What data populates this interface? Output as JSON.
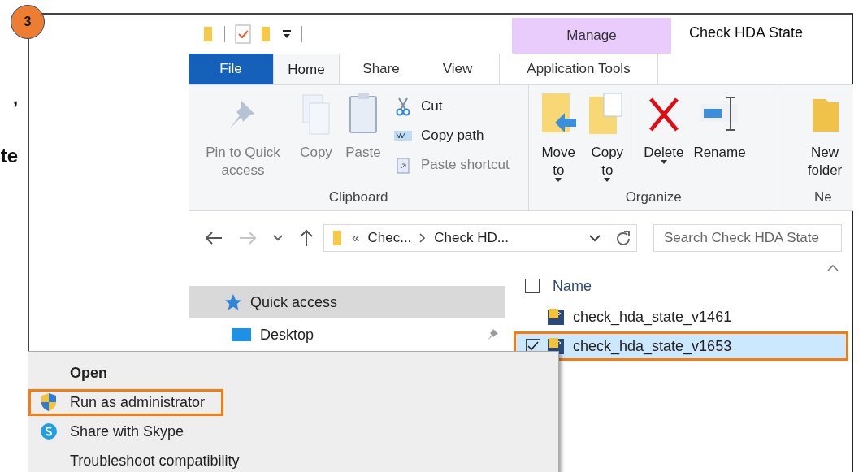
{
  "badge": "3",
  "left_text_fragments": [
    ",",
    "te"
  ],
  "explorer": {
    "title": "Check HDA State",
    "context_tab_group": "Manage",
    "tabs": [
      {
        "label": "File",
        "kind": "file",
        "selected": false
      },
      {
        "label": "Home",
        "kind": "normal",
        "selected": true
      },
      {
        "label": "Share",
        "kind": "normal",
        "selected": false
      },
      {
        "label": "View",
        "kind": "normal",
        "selected": false
      },
      {
        "label": "Application Tools",
        "kind": "contextual",
        "selected": false
      }
    ],
    "ribbon": {
      "groups": [
        {
          "name": "Clipboard",
          "large": [
            {
              "label": "Pin to Quick access",
              "disabled": true,
              "dropdown": false
            },
            {
              "label": "Copy",
              "disabled": true,
              "dropdown": false
            },
            {
              "label": "Paste",
              "disabled": true,
              "dropdown": false
            }
          ],
          "small": [
            {
              "label": "Cut",
              "disabled": false
            },
            {
              "label": "Copy path",
              "disabled": false
            },
            {
              "label": "Paste shortcut",
              "disabled": true
            }
          ]
        },
        {
          "name": "Organize",
          "large": [
            {
              "label": "Move to",
              "disabled": false,
              "dropdown": true
            },
            {
              "label": "Copy to",
              "disabled": false,
              "dropdown": true
            },
            {
              "label": "Delete",
              "disabled": false,
              "dropdown": true
            },
            {
              "label": "Rename",
              "disabled": false,
              "dropdown": false
            }
          ]
        },
        {
          "name": "Ne",
          "large": [
            {
              "label": "New folder",
              "disabled": false,
              "dropdown": false
            }
          ]
        }
      ]
    },
    "address": {
      "overflow": "«",
      "crumbs": [
        "Chec...",
        "Check HD..."
      ]
    },
    "search": {
      "placeholder": "Search Check HDA State"
    },
    "nav_pane": [
      {
        "label": "Quick access",
        "selected": true,
        "pinned": false
      },
      {
        "label": "Desktop",
        "selected": false,
        "pinned": true
      }
    ],
    "files": {
      "column": "Name",
      "select_all_checked": false,
      "rows": [
        {
          "name": "check_hda_state_v1461",
          "selected": false,
          "checked": false,
          "highlighted": false
        },
        {
          "name": "check_hda_state_v1653",
          "selected": true,
          "checked": true,
          "highlighted": true
        }
      ]
    }
  },
  "context_menu": [
    {
      "label": "Open",
      "default": true,
      "highlighted": false
    },
    {
      "label": "Run as administrator",
      "default": false,
      "highlighted": true
    },
    {
      "label": "Share with Skype",
      "default": false,
      "highlighted": false
    },
    {
      "label": "Troubleshoot compatibility",
      "default": false,
      "highlighted": false
    }
  ]
}
